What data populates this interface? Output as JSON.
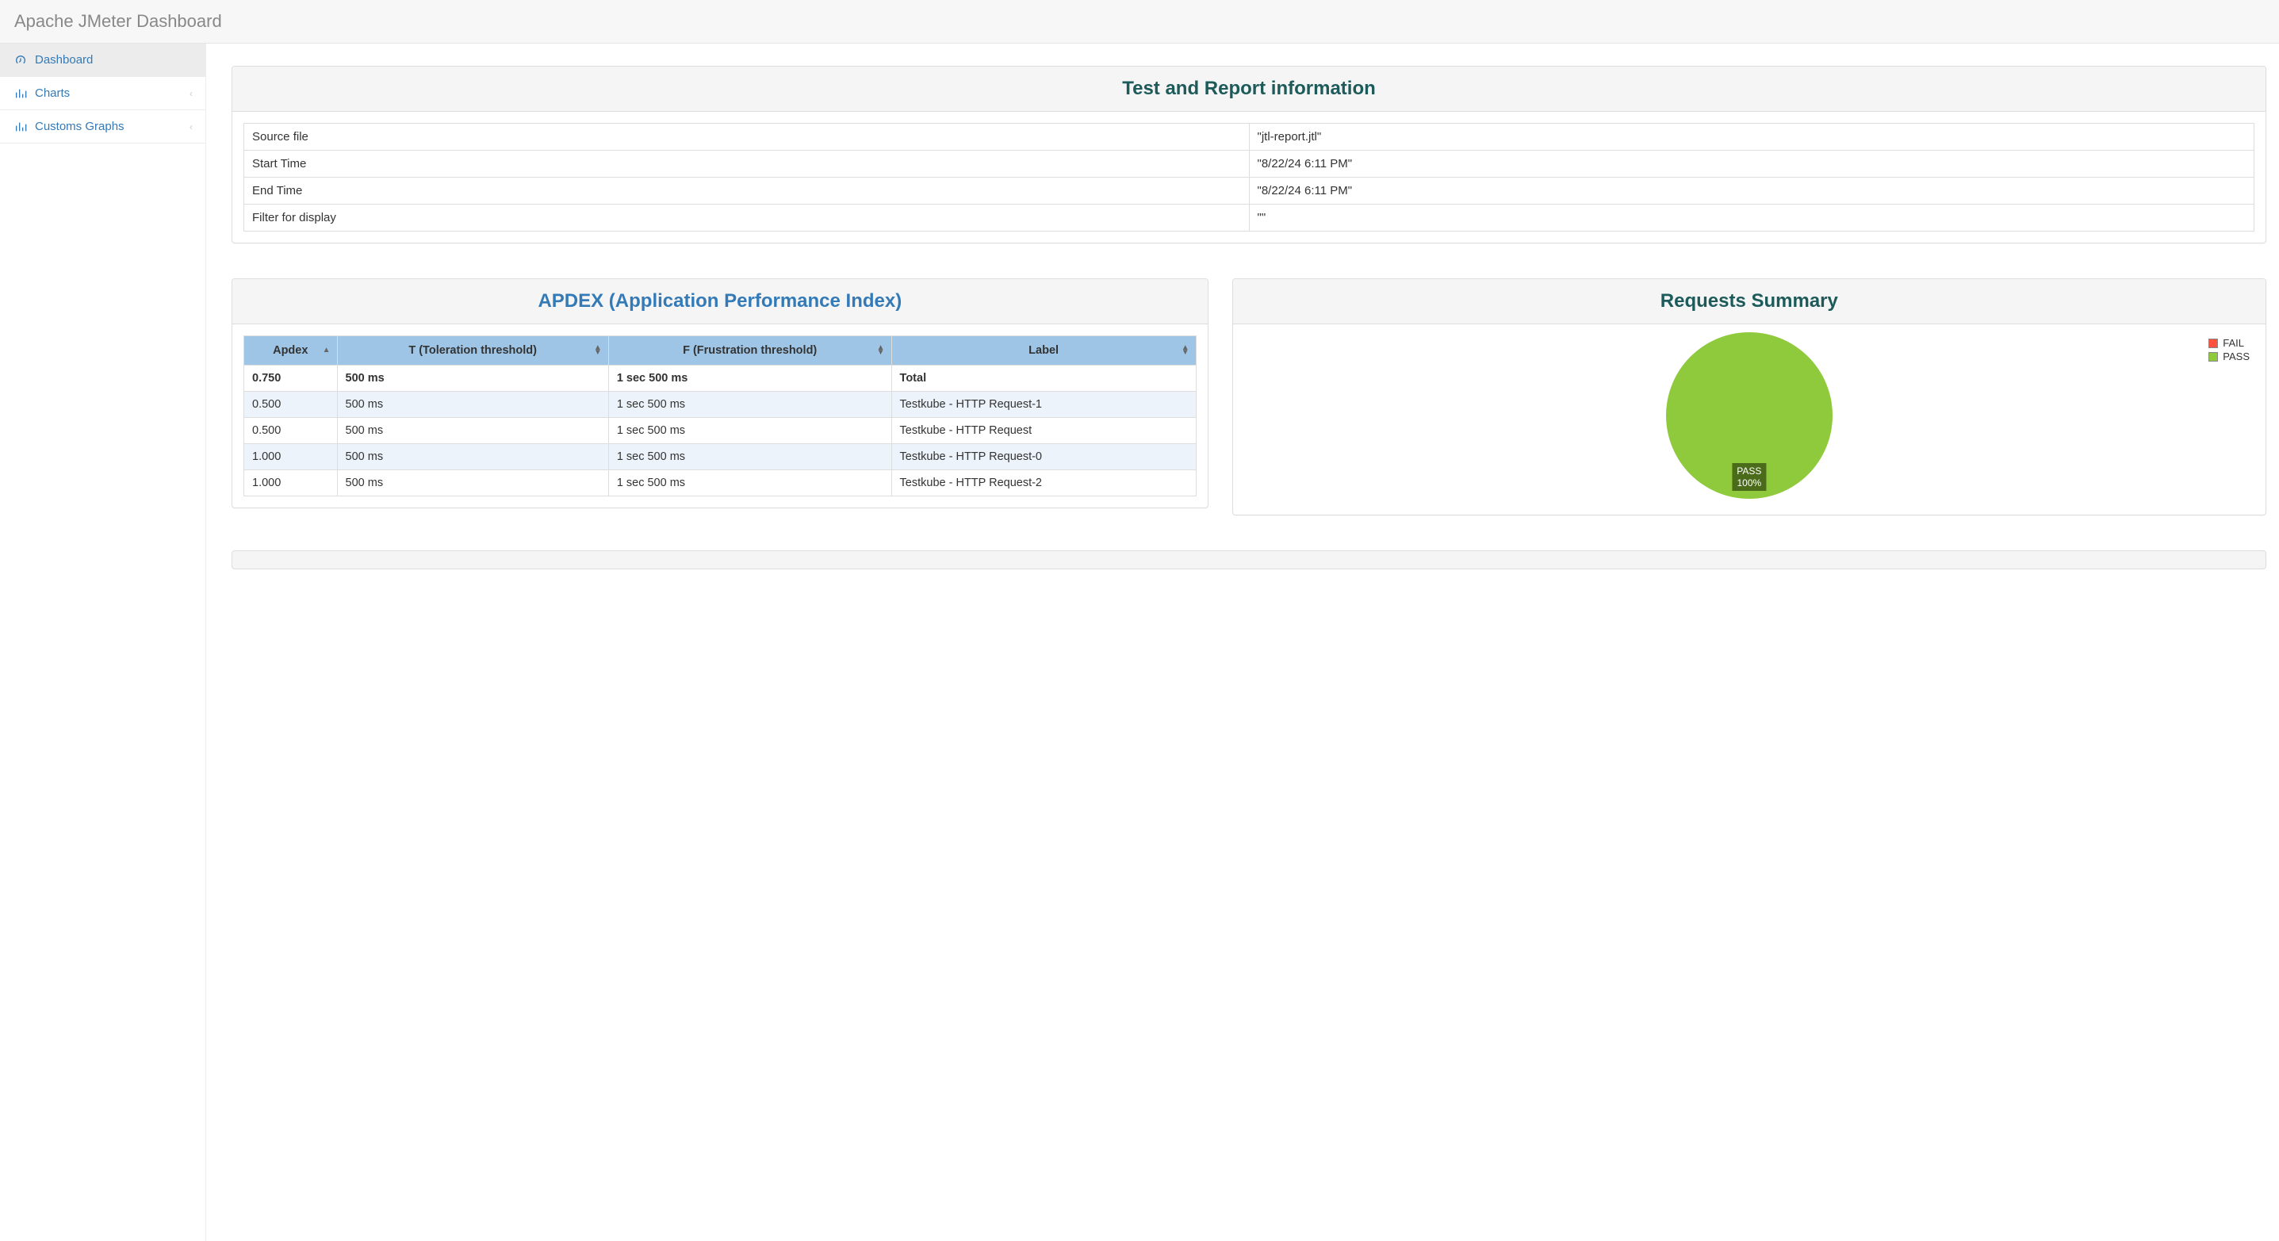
{
  "app_title": "Apache JMeter Dashboard",
  "sidebar": {
    "items": [
      {
        "label": "Dashboard",
        "icon": "tachometer",
        "active": true,
        "has_children": false
      },
      {
        "label": "Charts",
        "icon": "bar-chart",
        "active": false,
        "has_children": true
      },
      {
        "label": "Customs Graphs",
        "icon": "bar-chart",
        "active": false,
        "has_children": true
      }
    ]
  },
  "test_info": {
    "title": "Test and Report information",
    "rows": [
      {
        "key": "Source file",
        "value": "\"jtl-report.jtl\""
      },
      {
        "key": "Start Time",
        "value": "\"8/22/24 6:11 PM\""
      },
      {
        "key": "End Time",
        "value": "\"8/22/24 6:11 PM\""
      },
      {
        "key": "Filter for display",
        "value": "\"\""
      }
    ]
  },
  "apdex": {
    "title": "APDEX (Application Performance Index)",
    "columns": [
      {
        "label": "Apdex",
        "sort": "asc"
      },
      {
        "label": "T (Toleration threshold)",
        "sort": "both"
      },
      {
        "label": "F (Frustration threshold)",
        "sort": "both"
      },
      {
        "label": "Label",
        "sort": "both"
      }
    ],
    "rows": [
      {
        "apdex": "0.750",
        "t": "500 ms",
        "f": "1 sec 500 ms",
        "label": "Total",
        "total": true
      },
      {
        "apdex": "0.500",
        "t": "500 ms",
        "f": "1 sec 500 ms",
        "label": "Testkube - HTTP Request-1",
        "total": false
      },
      {
        "apdex": "0.500",
        "t": "500 ms",
        "f": "1 sec 500 ms",
        "label": "Testkube - HTTP Request",
        "total": false
      },
      {
        "apdex": "1.000",
        "t": "500 ms",
        "f": "1 sec 500 ms",
        "label": "Testkube - HTTP Request-0",
        "total": false
      },
      {
        "apdex": "1.000",
        "t": "500 ms",
        "f": "1 sec 500 ms",
        "label": "Testkube - HTTP Request-2",
        "total": false
      }
    ]
  },
  "requests_summary": {
    "title": "Requests Summary",
    "legend": [
      {
        "label": "FAIL",
        "color": "#ff523e"
      },
      {
        "label": "PASS",
        "color": "#8fc93c"
      }
    ],
    "pie_label_line1": "PASS",
    "pie_label_line2": "100%"
  },
  "chart_data": {
    "type": "pie",
    "title": "Requests Summary",
    "series": [
      {
        "name": "PASS",
        "value": 100,
        "color": "#8fc93c"
      },
      {
        "name": "FAIL",
        "value": 0,
        "color": "#ff523e"
      }
    ]
  }
}
